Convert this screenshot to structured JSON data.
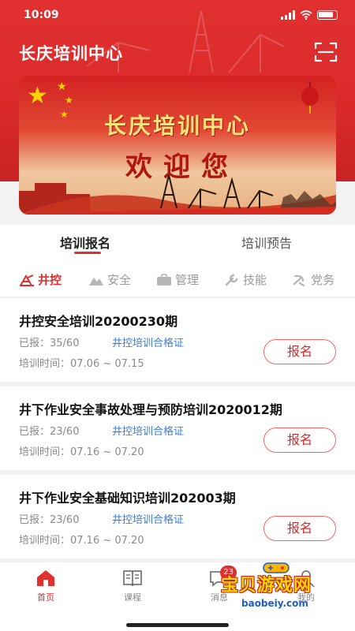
{
  "status_bar": {
    "time": "10:09"
  },
  "header": {
    "title": "长庆培训中心",
    "scan_icon": "scan-icon"
  },
  "banner": {
    "title": "长庆培训中心",
    "subtitle": "欢迎您"
  },
  "tabs": [
    {
      "label": "培训报名",
      "active": true
    },
    {
      "label": "培训预告",
      "active": false
    }
  ],
  "categories": [
    {
      "label": "井控",
      "icon": "derrick-icon",
      "active": true
    },
    {
      "label": "安全",
      "icon": "mountain-icon",
      "active": false
    },
    {
      "label": "管理",
      "icon": "briefcase-icon",
      "active": false
    },
    {
      "label": "技能",
      "icon": "wrench-icon",
      "active": false
    },
    {
      "label": "党务",
      "icon": "party-emblem-icon",
      "active": false
    }
  ],
  "courses": [
    {
      "title": "井控安全培训20200230期",
      "enrolled": "已报：35/60",
      "cert": "井控培训合格证",
      "period": "培训时间：07.06 ~ 07.15",
      "button": "报名"
    },
    {
      "title": "井下作业安全事故处理与预防培训2020012期",
      "enrolled": "已报：23/60",
      "cert": "井控培训合格证",
      "period": "培训时间：07.16 ~ 07.20",
      "button": "报名"
    },
    {
      "title": "井下作业安全基础知识培训202003期",
      "enrolled": "已报：23/60",
      "cert": "井控培训合格证",
      "period": "培训时间：07.16 ~ 07.20",
      "button": "报名"
    }
  ],
  "tabbar": [
    {
      "label": "首页",
      "icon": "home-icon",
      "active": true
    },
    {
      "label": "课程",
      "icon": "book-icon",
      "active": false
    },
    {
      "label": "消息",
      "icon": "message-icon",
      "active": false,
      "badge": "23"
    },
    {
      "label": "我的",
      "icon": "user-icon",
      "active": false
    }
  ],
  "watermark": {
    "text": "宝贝游戏网",
    "url": "baobeiy.com"
  },
  "colors": {
    "primary": "#e23030",
    "link": "#3a7bd5"
  }
}
